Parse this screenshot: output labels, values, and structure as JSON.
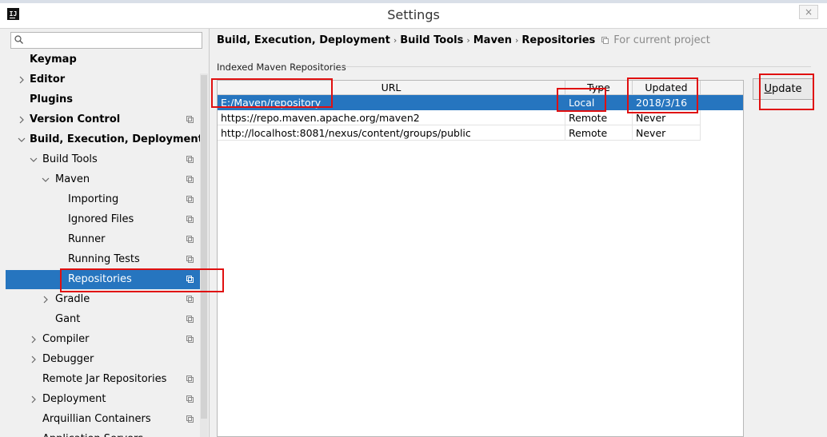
{
  "window": {
    "title": "Settings",
    "app_icon_text": "IJ",
    "close_symbol": "×"
  },
  "sidebar": {
    "search": {
      "placeholder": "",
      "value": ""
    },
    "items": [
      {
        "label": "Keymap",
        "bold": true,
        "depth": 0,
        "arrow": ""
      },
      {
        "label": "Editor",
        "bold": true,
        "depth": 0,
        "arrow": "collapsed"
      },
      {
        "label": "Plugins",
        "bold": true,
        "depth": 0,
        "arrow": ""
      },
      {
        "label": "Version Control",
        "bold": true,
        "depth": 0,
        "arrow": "collapsed",
        "project_icon": true
      },
      {
        "label": "Build, Execution, Deployment",
        "bold": true,
        "depth": 0,
        "arrow": "expanded"
      },
      {
        "label": "Build Tools",
        "bold": false,
        "depth": 1,
        "arrow": "expanded",
        "project_icon": true
      },
      {
        "label": "Maven",
        "bold": false,
        "depth": 2,
        "arrow": "expanded",
        "project_icon": true
      },
      {
        "label": "Importing",
        "bold": false,
        "depth": 3,
        "arrow": "",
        "project_icon": true
      },
      {
        "label": "Ignored Files",
        "bold": false,
        "depth": 3,
        "arrow": "",
        "project_icon": true
      },
      {
        "label": "Runner",
        "bold": false,
        "depth": 3,
        "arrow": "",
        "project_icon": true
      },
      {
        "label": "Running Tests",
        "bold": false,
        "depth": 3,
        "arrow": "",
        "project_icon": true
      },
      {
        "label": "Repositories",
        "bold": false,
        "depth": 3,
        "arrow": "",
        "project_icon": true,
        "selected": true
      },
      {
        "label": "Gradle",
        "bold": false,
        "depth": 2,
        "arrow": "collapsed",
        "project_icon": true
      },
      {
        "label": "Gant",
        "bold": false,
        "depth": 2,
        "arrow": "",
        "project_icon": true
      },
      {
        "label": "Compiler",
        "bold": false,
        "depth": 1,
        "arrow": "collapsed",
        "project_icon": true
      },
      {
        "label": "Debugger",
        "bold": false,
        "depth": 1,
        "arrow": "collapsed"
      },
      {
        "label": "Remote Jar Repositories",
        "bold": false,
        "depth": 1,
        "arrow": "",
        "project_icon": true
      },
      {
        "label": "Deployment",
        "bold": false,
        "depth": 1,
        "arrow": "collapsed",
        "project_icon": true
      },
      {
        "label": "Arquillian Containers",
        "bold": false,
        "depth": 1,
        "arrow": "",
        "project_icon": true
      },
      {
        "label": "Application Servers",
        "bold": false,
        "depth": 1,
        "arrow": ""
      }
    ]
  },
  "breadcrumb": {
    "parts": [
      "Build, Execution, Deployment",
      "Build Tools",
      "Maven",
      "Repositories"
    ],
    "separator": "›",
    "hint": "For current project"
  },
  "section_label": "Indexed Maven Repositories",
  "table": {
    "columns": [
      "URL",
      "Type",
      "Updated"
    ],
    "rows": [
      {
        "url": "E:/Maven/repository",
        "type": "Local",
        "updated": "2018/3/16",
        "selected": true
      },
      {
        "url": "https://repo.maven.apache.org/maven2",
        "type": "Remote",
        "updated": "Never"
      },
      {
        "url": "http://localhost:8081/nexus/content/groups/public",
        "type": "Remote",
        "updated": "Never"
      }
    ]
  },
  "update_button": {
    "mnemonic": "U",
    "rest": "pdate"
  },
  "colors": {
    "selection": "#2675bf",
    "annotation": "#e01010"
  },
  "icons": [
    "app-icon",
    "search-icon",
    "project-settings-icon",
    "chevron-right-icon",
    "chevron-down-icon",
    "close-icon"
  ]
}
